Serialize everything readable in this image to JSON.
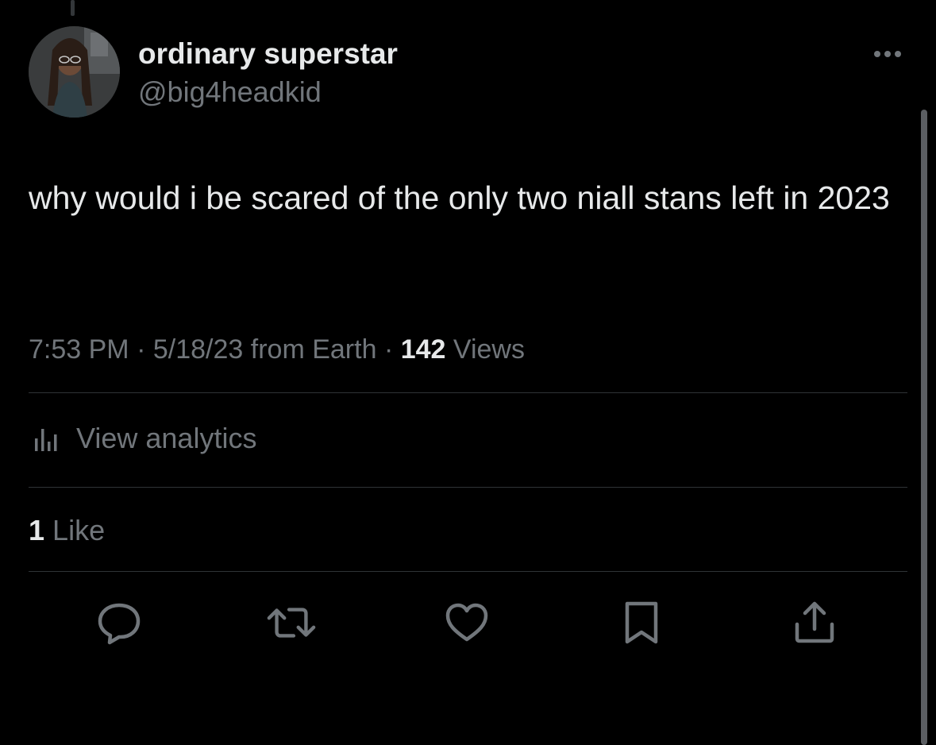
{
  "tweet": {
    "author": {
      "display_name": "ordinary superstar",
      "handle": "@big4headkid"
    },
    "text": "why would i be scared of the only two niall stans left in 2023",
    "meta": {
      "time": "7:53 PM",
      "date": "5/18/23",
      "from": "from Earth",
      "separator": "·",
      "views_count": "142",
      "views_label": "Views"
    },
    "analytics_label": "View analytics",
    "likes": {
      "count": "1",
      "label": "Like"
    },
    "actions": [
      "reply-icon",
      "retweet-icon",
      "like-icon",
      "bookmark-icon",
      "share-icon"
    ]
  },
  "colors": {
    "background": "#000000",
    "primary_text": "#e7e9ea",
    "secondary_text": "#71767b",
    "divider": "#2f3336"
  }
}
